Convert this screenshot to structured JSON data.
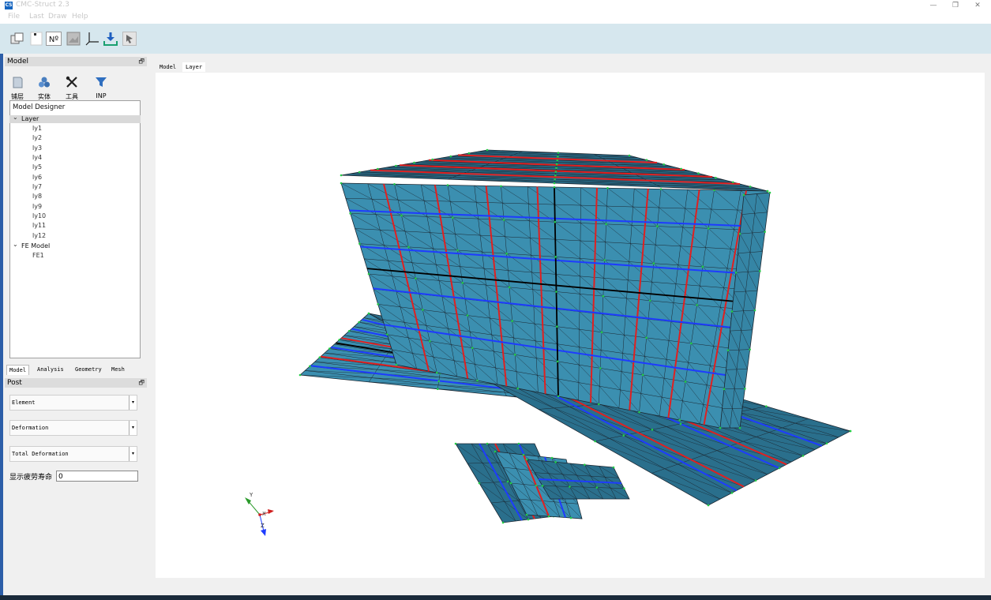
{
  "window": {
    "title": "CMC-Struct  2.3",
    "minimize": "—",
    "restore": "❐",
    "close": "✕"
  },
  "menu": [
    "File",
    "Last",
    "Draw",
    "Help"
  ],
  "toolbar": {
    "buttons": [
      "layers-icon",
      "new-icon",
      "numbering-icon",
      "image-icon",
      "axes-icon",
      "download-icon",
      "pointer-icon"
    ],
    "number_label": "Nº"
  },
  "model_panel": {
    "title": "Model",
    "float_icon": "🗗",
    "tools": [
      {
        "label": "铺层",
        "icon": "ply-icon"
      },
      {
        "label": "实体",
        "icon": "solid-icon"
      },
      {
        "label": "工具",
        "icon": "tools-icon"
      },
      {
        "label": "INP",
        "icon": "filter-icon"
      }
    ],
    "tree": {
      "root": "Model Designer",
      "layer_group": "Layer",
      "layers": [
        "ly1",
        "ly2",
        "ly3",
        "ly4",
        "ly5",
        "ly6",
        "ly7",
        "ly8",
        "ly9",
        "ly10",
        "ly11",
        "ly12"
      ],
      "fe_group": "FE Model",
      "fe_items": [
        "FE1"
      ],
      "expand_glyph": "⌄"
    },
    "bottom_tabs": [
      "Model",
      "Analysis",
      "Geometry",
      "Mesh"
    ]
  },
  "post_panel": {
    "title": "Post",
    "float_icon": "🗗",
    "selects": [
      "Element",
      "Deformation",
      "Total Deformation"
    ],
    "arrow": "▾",
    "fatigue_label": "显示疲劳寿命",
    "fatigue_value": "0"
  },
  "viewport": {
    "tabs": [
      "Model",
      "Layer"
    ],
    "active_tab": "Layer",
    "axes": {
      "y": "Y",
      "x": "X",
      "z": "Z"
    },
    "colors": {
      "mesh_fill": "#3b8fb0",
      "mesh_fill_dark": "#2a6f8c",
      "edge": "#1b2630",
      "red_line": "#e02020",
      "blue_line": "#1e3cff",
      "node": "#22cc44"
    }
  }
}
